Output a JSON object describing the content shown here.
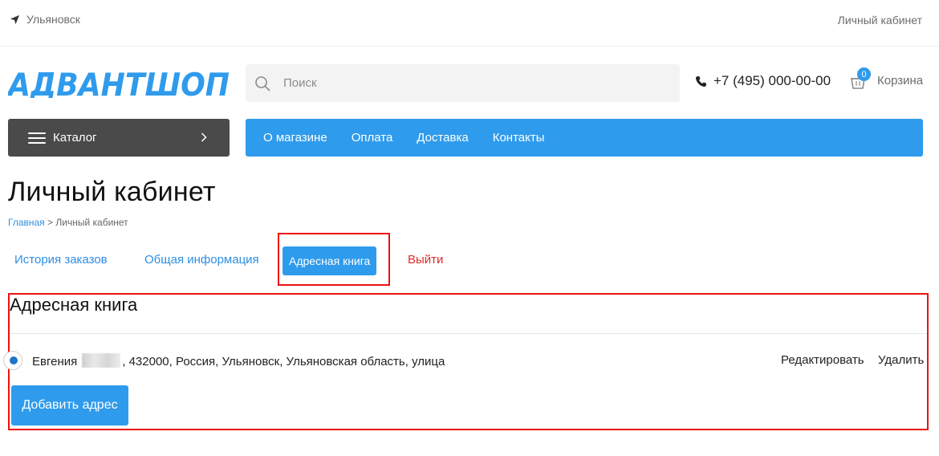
{
  "top_bar": {
    "city": "Ульяновск",
    "account_link": "Личный кабинет"
  },
  "header": {
    "logo_text": "АДВАНТШОП",
    "search_placeholder": "Поиск",
    "phone": "+7 (495) 000-00-00",
    "cart_count": "0",
    "cart_label": "Корзина"
  },
  "nav": {
    "catalog_label": "Каталог",
    "menu_items": [
      "О магазине",
      "Оплата",
      "Доставка",
      "Контакты"
    ]
  },
  "page": {
    "title": "Личный кабинет",
    "breadcrumb": {
      "home": "Главная",
      "separator": ">",
      "current": "Личный кабинет"
    }
  },
  "tabs": [
    "История заказов",
    "Общая информация",
    "Адресная книга",
    "Выйти"
  ],
  "address_book": {
    "title": "Адресная книга",
    "address": {
      "name": "Евгения",
      "details": ", 432000, Россия, Ульяновск, Ульяновская область, улица"
    },
    "edit_label": "Редактировать",
    "delete_label": "Удалить",
    "add_button": "Добавить адрес"
  },
  "colors": {
    "accent": "#2f9bec",
    "catalog_bg": "#4a4a4a",
    "logout": "#e02b2b",
    "highlight": "#ee1111"
  }
}
